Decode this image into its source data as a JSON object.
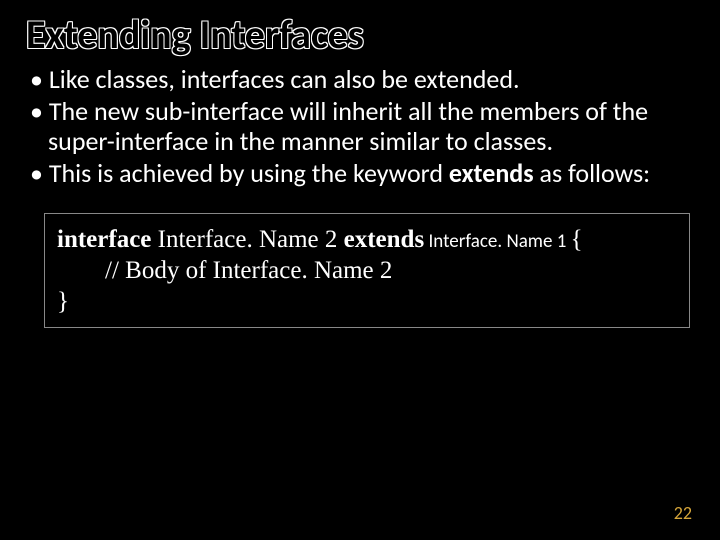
{
  "slide": {
    "title": "Extending Interfaces",
    "bullets": [
      "Like classes, interfaces can also be extended.",
      "The new sub-interface will inherit all the members of the super-interface in the manner similar to classes.",
      "This is achieved by using the keyword "
    ],
    "bullet3_bold": "extends",
    "bullet3_tail": " as follows:",
    "code": {
      "kw_interface": "interface",
      "name2": " Interface. Name 2 ",
      "kw_extends": "extends",
      "name1": " Interface. Name 1 ",
      "brace_open": "{",
      "body_comment": "// Body of Interface. Name 2",
      "brace_close": "}"
    },
    "page_number": "22"
  }
}
